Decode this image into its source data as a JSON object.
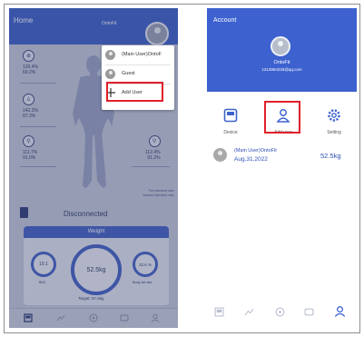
{
  "left_screen": {
    "header": {
      "title": "Home",
      "brand": "OntoFit"
    },
    "metrics": [
      {
        "v1": "126.4%",
        "v2": "69.2%"
      },
      {
        "v1": "142.3%",
        "v2": "87.3%"
      },
      {
        "v1": "111.7%",
        "v2": "91.0%"
      },
      {
        "v1": "112.4%",
        "v2": "91.2%"
      }
    ],
    "figure_notes": [
      "Fat standard ratio",
      "Muscle standard ratio"
    ],
    "status": "Disconnected",
    "weight_panel": {
      "title": "Weight",
      "center_value": "52.5kg",
      "left_value": "19.1",
      "left_label": "BMI",
      "right_value": "32.6 %",
      "right_label": "Body fat rate",
      "target": "Target: 57.5kg"
    },
    "user_menu": {
      "items": [
        {
          "label": "(Main User)OntoF"
        },
        {
          "label": "Guest"
        },
        {
          "label": "Add User"
        }
      ]
    }
  },
  "right_screen": {
    "header": {
      "title": "Account",
      "name": "OntoFit",
      "email": "1213954225@qq.com"
    },
    "actions": [
      {
        "label": "Device",
        "icon": "device-icon"
      },
      {
        "label": "Add user",
        "icon": "add-user-icon"
      },
      {
        "label": "Setting",
        "icon": "gear-icon"
      }
    ],
    "record": {
      "name": "(Main User)OntoFit",
      "date": "Aug.31,2022",
      "weight": "52.5kg"
    }
  },
  "colors": {
    "accent": "#3d62cf",
    "highlight": "#e0202a",
    "text_blue": "#2f4fb6"
  }
}
